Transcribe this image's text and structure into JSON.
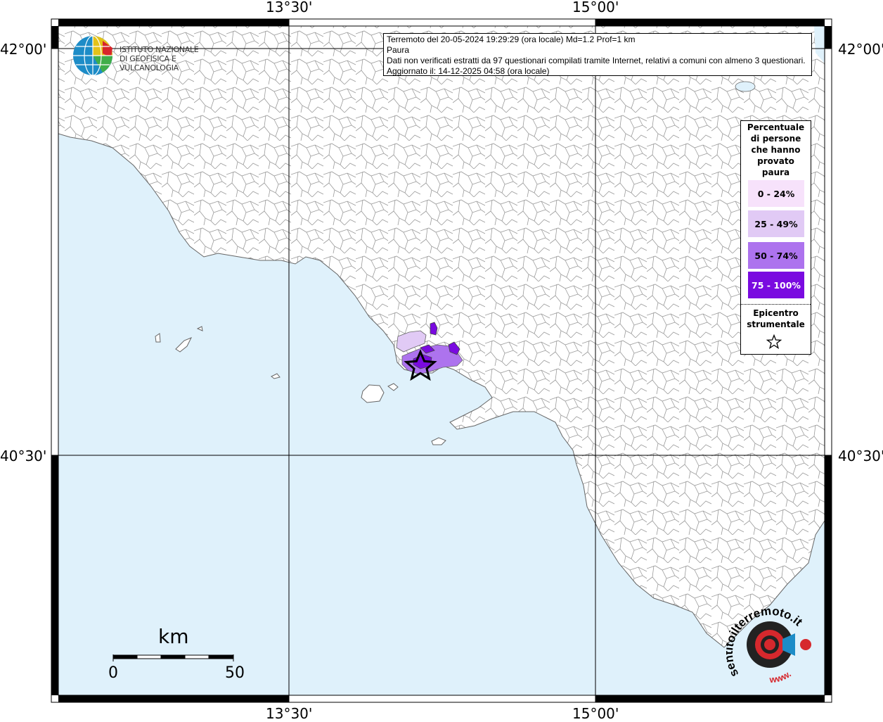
{
  "map": {
    "grid_labels": {
      "lon_left": "13°30'",
      "lon_right": "15°00'",
      "lat_top": "42°00'",
      "lat_bottom": "40°30'"
    },
    "colors": {
      "sea": "#dff1fb",
      "land": "#ffffff",
      "borders": "#8a8a8a",
      "frame": "#000000"
    }
  },
  "logo": {
    "line1": "ISTITUTO NAZIONALE",
    "line2": "DI GEOFISICA E VULCANOLOGIA",
    "icon": "ingv-globe-icon"
  },
  "info": {
    "line1": "Terremoto del 20-05-2024 19:29:29 (ora locale) Md=1.2 Prof=1 km",
    "line2": "Paura",
    "line3": "Dati non verificati estratti da 97 questionari compilati tramite Internet, relativi a comuni con almeno 3 questionari.",
    "line4": "Aggiornato il: 14-12-2025 04:58 (ora locale)"
  },
  "legend": {
    "title_lines": [
      "Percentuale",
      "di persone",
      "che hanno",
      "provato",
      "paura"
    ],
    "classes": [
      {
        "label": "0 - 24%",
        "color": "#f7e2fb",
        "text_color": "#000000"
      },
      {
        "label": "25 - 49%",
        "color": "#e1caf5",
        "text_color": "#000000"
      },
      {
        "label": "50 - 74%",
        "color": "#ad73ee",
        "text_color": "#000000"
      },
      {
        "label": "75 - 100%",
        "color": "#7a0ae0",
        "text_color": "#ffffff"
      }
    ],
    "epicenter_line1": "Epicentro",
    "epicenter_line2": "strumentale",
    "epicenter_icon": "star-icon"
  },
  "scale": {
    "unit": "km",
    "start": "0",
    "end": "50"
  },
  "sentito_logo": {
    "text": "sentitoilterremoto.it",
    "url_text": "www.",
    "icon": "speaker-logo-icon"
  }
}
